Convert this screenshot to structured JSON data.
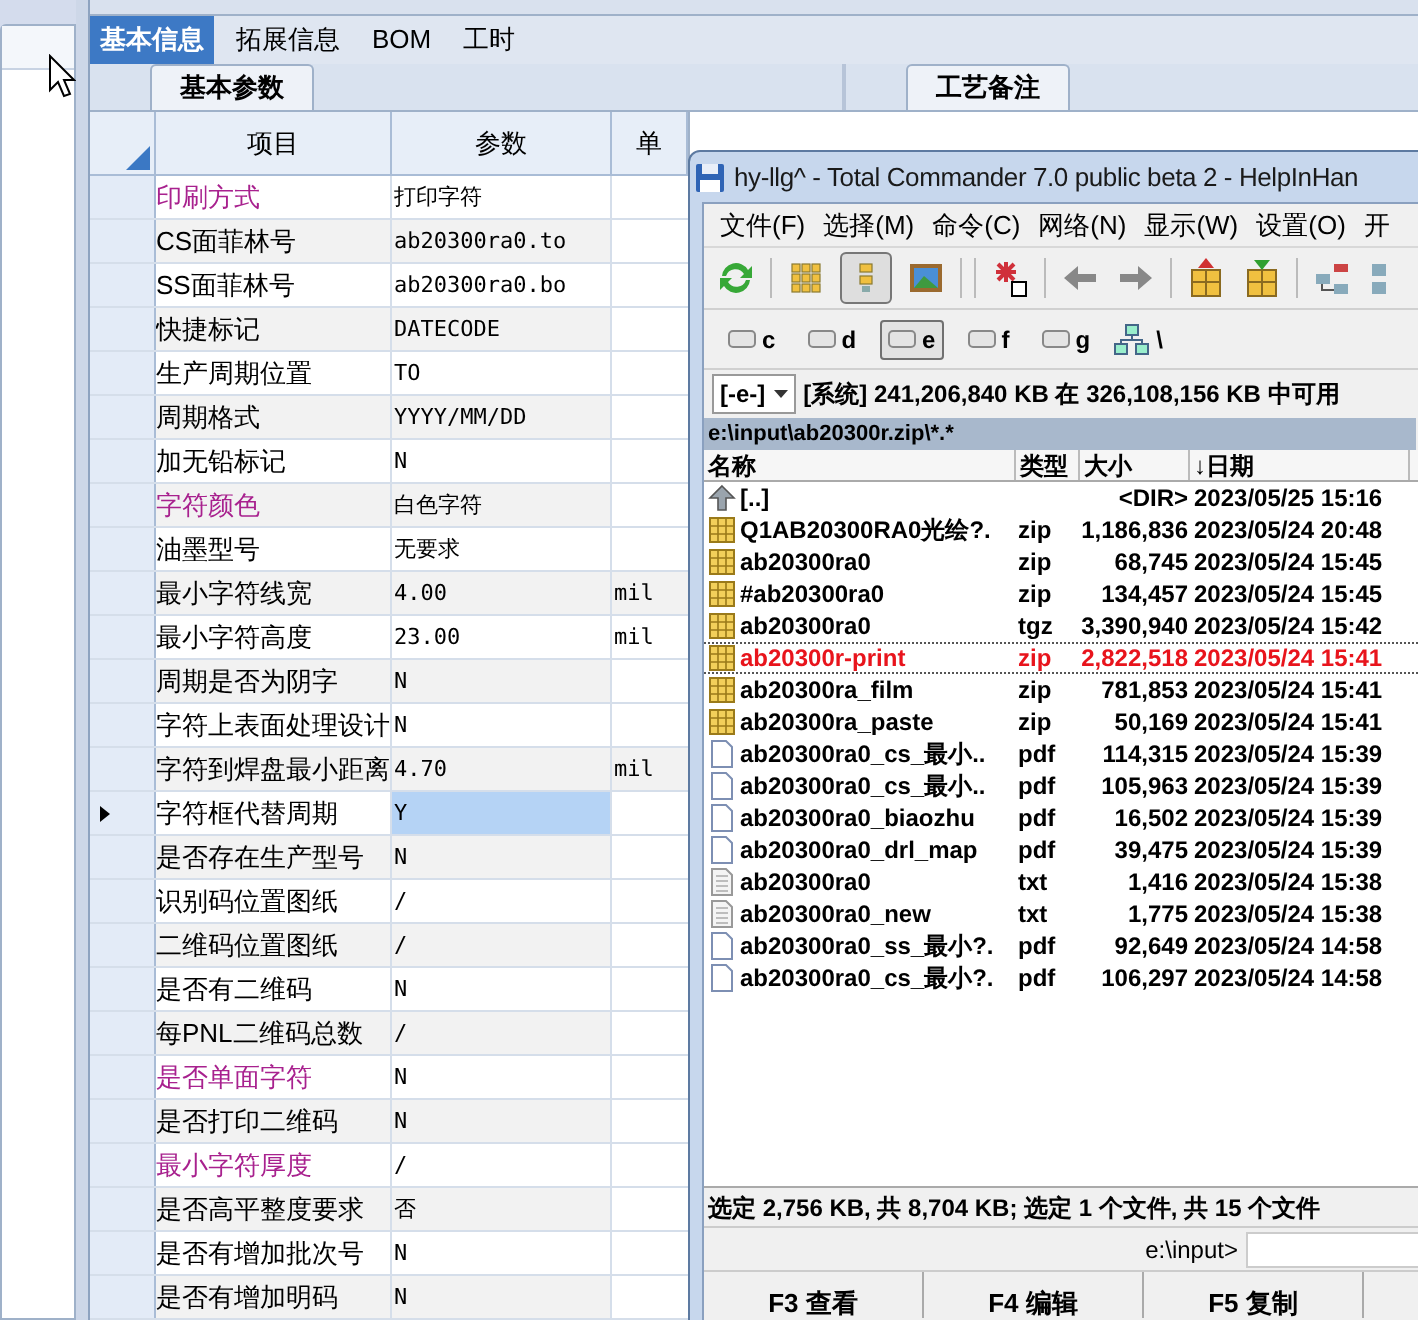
{
  "app": {
    "tabs": [
      {
        "label": "基本信息",
        "selected": true
      },
      {
        "label": "拓展信息",
        "selected": false
      },
      {
        "label": "BOM",
        "selected": false
      },
      {
        "label": "工时",
        "selected": false
      }
    ],
    "left_subtab": "基本参数",
    "right_subtab": "工艺备注",
    "grid": {
      "columns": [
        "项目",
        "参数",
        "单"
      ],
      "rows": [
        {
          "item": "印刷方式",
          "value": "打印字符",
          "color": "#a8218e",
          "current": false
        },
        {
          "item": "CS面菲林号",
          "value": "ab20300ra0.to",
          "color": "#000000",
          "current": false
        },
        {
          "item": "SS面菲林号",
          "value": "ab20300ra0.bo",
          "color": "#000000",
          "current": false
        },
        {
          "item": "快捷标记",
          "value": "DATECODE",
          "color": "#000000",
          "current": false
        },
        {
          "item": "生产周期位置",
          "value": "TO",
          "color": "#000000",
          "current": false
        },
        {
          "item": "周期格式",
          "value": "YYYY/MM/DD",
          "color": "#000000",
          "current": false
        },
        {
          "item": "加无铅标记",
          "value": "N",
          "color": "#000000",
          "current": false
        },
        {
          "item": "字符颜色",
          "value": "白色字符",
          "color": "#a8218e",
          "current": false
        },
        {
          "item": "油墨型号",
          "value": "无要求",
          "color": "#000000",
          "current": false
        },
        {
          "item": "最小字符线宽",
          "value": "4.00",
          "unit": "mil",
          "color": "#000000",
          "current": false
        },
        {
          "item": "最小字符高度",
          "value": "23.00",
          "unit": "mil",
          "color": "#000000",
          "current": false
        },
        {
          "item": "周期是否为阴字",
          "value": "N",
          "color": "#000000",
          "current": false
        },
        {
          "item": "字符上表面处理设计",
          "value": "N",
          "color": "#000000",
          "current": false
        },
        {
          "item": "字符到焊盘最小距离",
          "value": "4.70",
          "unit": "mil",
          "color": "#000000",
          "current": false
        },
        {
          "item": "字符框代替周期",
          "value": "Y",
          "color": "#000000",
          "current": true
        },
        {
          "item": "是否存在生产型号",
          "value": "N",
          "color": "#000000",
          "current": false
        },
        {
          "item": "识别码位置图纸",
          "value": "/",
          "color": "#000000",
          "current": false
        },
        {
          "item": "二维码位置图纸",
          "value": "/",
          "color": "#000000",
          "current": false
        },
        {
          "item": "是否有二维码",
          "value": "N",
          "color": "#000000",
          "current": false
        },
        {
          "item": "每PNL二维码总数",
          "value": "/",
          "color": "#000000",
          "current": false
        },
        {
          "item": "是否单面字符",
          "value": "N",
          "color": "#a8218e",
          "current": false
        },
        {
          "item": "是否打印二维码",
          "value": "N",
          "color": "#000000",
          "current": false
        },
        {
          "item": "最小字符厚度",
          "value": "/",
          "color": "#a8218e",
          "current": false
        },
        {
          "item": "是否高平整度要求",
          "value": "否",
          "color": "#000000",
          "current": false
        },
        {
          "item": "是否有增加批次号",
          "value": "N",
          "color": "#000000",
          "current": false
        },
        {
          "item": "是否有增加明码",
          "value": "N",
          "color": "#000000",
          "current": false
        }
      ]
    }
  },
  "commander": {
    "title": "hy-llg^ - Total Commander 7.0 public beta 2 - HelpInHan",
    "menu": [
      "文件(F)",
      "选择(M)",
      "命令(C)",
      "网络(N)",
      "显示(W)",
      "设置(O)",
      "开"
    ],
    "drives": [
      {
        "label": "c",
        "selected": false
      },
      {
        "label": "d",
        "selected": false
      },
      {
        "label": "e",
        "selected": true
      },
      {
        "label": "f",
        "selected": false
      },
      {
        "label": "g",
        "selected": false
      }
    ],
    "network_label": "\\",
    "drive_select": "[-e-]",
    "free_space": "[系统] 241,206,840 KB 在 326,108,156 KB 中可用",
    "path": "e:\\input\\ab20300r.zip\\*.*",
    "columns": [
      "名称",
      "类型",
      "大小",
      "↓日期"
    ],
    "files": [
      {
        "kind": "up",
        "name": "[..]",
        "size": "<DIR>",
        "date": "2023/05/25 15:16",
        "marked": false
      },
      {
        "kind": "archive",
        "name": "Q1AB20300RA0光绘?.",
        "type": "zip",
        "size": "1,186,836",
        "date": "2023/05/24 20:48",
        "marked": false
      },
      {
        "kind": "archive",
        "name": "ab20300ra0",
        "type": "zip",
        "size": "68,745",
        "date": "2023/05/24 15:45",
        "marked": false
      },
      {
        "kind": "archive",
        "name": "#ab20300ra0",
        "type": "zip",
        "size": "134,457",
        "date": "2023/05/24 15:45",
        "marked": false
      },
      {
        "kind": "archive",
        "name": "ab20300ra0",
        "type": "tgz",
        "size": "3,390,940",
        "date": "2023/05/24 15:42",
        "marked": false
      },
      {
        "kind": "archive",
        "name": "ab20300r-print",
        "type": "zip",
        "size": "2,822,518",
        "date": "2023/05/24 15:41",
        "marked": true
      },
      {
        "kind": "archive",
        "name": "ab20300ra_film",
        "type": "zip",
        "size": "781,853",
        "date": "2023/05/24 15:41",
        "marked": false
      },
      {
        "kind": "archive",
        "name": "ab20300ra_paste",
        "type": "zip",
        "size": "50,169",
        "date": "2023/05/24 15:41",
        "marked": false
      },
      {
        "kind": "pdf",
        "name": "ab20300ra0_cs_最小..",
        "type": "pdf",
        "size": "114,315",
        "date": "2023/05/24 15:39",
        "marked": false
      },
      {
        "kind": "pdf",
        "name": "ab20300ra0_cs_最小..",
        "type": "pdf",
        "size": "105,963",
        "date": "2023/05/24 15:39",
        "marked": false
      },
      {
        "kind": "pdf",
        "name": "ab20300ra0_biaozhu",
        "type": "pdf",
        "size": "16,502",
        "date": "2023/05/24 15:39",
        "marked": false
      },
      {
        "kind": "pdf",
        "name": "ab20300ra0_drl_map",
        "type": "pdf",
        "size": "39,475",
        "date": "2023/05/24 15:39",
        "marked": false
      },
      {
        "kind": "txt",
        "name": "ab20300ra0",
        "type": "txt",
        "size": "1,416",
        "date": "2023/05/24 15:38",
        "marked": false
      },
      {
        "kind": "txt",
        "name": "ab20300ra0_new",
        "type": "txt",
        "size": "1,775",
        "date": "2023/05/24 15:38",
        "marked": false
      },
      {
        "kind": "pdf",
        "name": "ab20300ra0_ss_最小?.",
        "type": "pdf",
        "size": "92,649",
        "date": "2023/05/24 14:58",
        "marked": false
      },
      {
        "kind": "pdf",
        "name": "ab20300ra0_cs_最小?.",
        "type": "pdf",
        "size": "106,297",
        "date": "2023/05/24 14:58",
        "marked": false
      }
    ],
    "status": "选定 2,756 KB, 共 8,704 KB; 选定 1 个文件, 共 15 个文件",
    "prompt": "e:\\input>",
    "function_keys": [
      "F3 查看",
      "F4 编辑",
      "F5 复制"
    ]
  }
}
